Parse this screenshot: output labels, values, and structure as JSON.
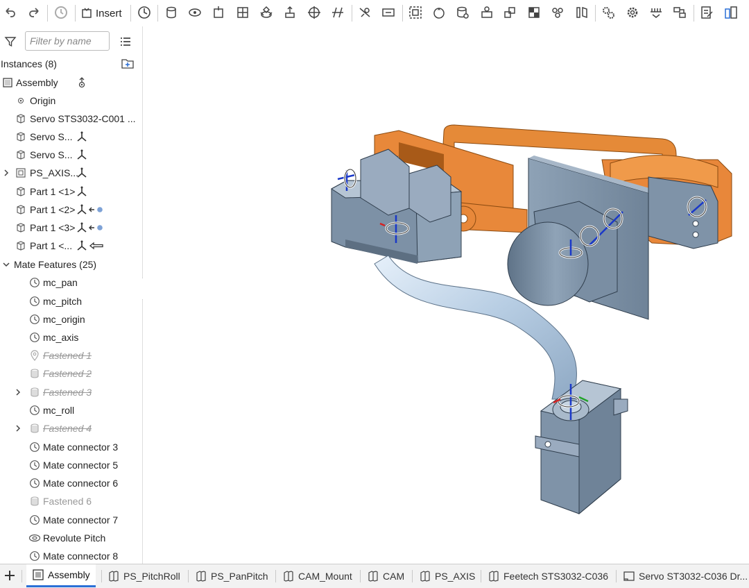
{
  "toolbar": {
    "insert_label": "Insert"
  },
  "filter": {
    "placeholder": "Filter by name"
  },
  "tree": {
    "instances_header": "Instances (8)",
    "assembly_label": "Assembly",
    "items": [
      {
        "label": "Origin"
      },
      {
        "label": "Servo STS3032-C001 ..."
      },
      {
        "label": "Servo S..."
      },
      {
        "label": "Servo S..."
      },
      {
        "label": "PS_AXIS..."
      },
      {
        "label": "Part 1 <1>"
      },
      {
        "label": "Part 1 <2>"
      },
      {
        "label": "Part 1 <3>"
      },
      {
        "label": "Part 1 <..."
      }
    ],
    "mates_header": "Mate Features (25)",
    "mates": [
      {
        "label": "mc_pan",
        "state": "normal"
      },
      {
        "label": "mc_pitch",
        "state": "normal"
      },
      {
        "label": "mc_origin",
        "state": "normal"
      },
      {
        "label": "mc_axis",
        "state": "normal"
      },
      {
        "label": "Fastened 1",
        "state": "suppressed"
      },
      {
        "label": "Fastened 2",
        "state": "suppressed"
      },
      {
        "label": "Fastened 3",
        "state": "suppressed"
      },
      {
        "label": "mc_roll",
        "state": "normal"
      },
      {
        "label": "Fastened 4",
        "state": "suppressed"
      },
      {
        "label": "Mate connector 3",
        "state": "normal"
      },
      {
        "label": "Mate connector 5",
        "state": "normal"
      },
      {
        "label": "Mate connector 6",
        "state": "normal"
      },
      {
        "label": "Fastened 6",
        "state": "dimmed"
      },
      {
        "label": "Mate connector 7",
        "state": "normal"
      },
      {
        "label": "Revolute Pitch",
        "state": "normal"
      },
      {
        "label": "Mate connector 8",
        "state": "normal"
      }
    ]
  },
  "tabs": [
    {
      "label": "Assembly",
      "active": true
    },
    {
      "label": "PS_PitchRoll"
    },
    {
      "label": "PS_PanPitch"
    },
    {
      "label": "CAM_Mount"
    },
    {
      "label": "CAM"
    },
    {
      "label": "PS_AXIS"
    },
    {
      "label": "Feetech STS3032-C036"
    },
    {
      "label": "Servo ST3032-C036 Dr..."
    }
  ],
  "colors": {
    "accent": "#2a6fd6",
    "part_orange": "#e8883a",
    "part_steel": "#7f93a8",
    "part_tube": "#bcd3e8"
  }
}
